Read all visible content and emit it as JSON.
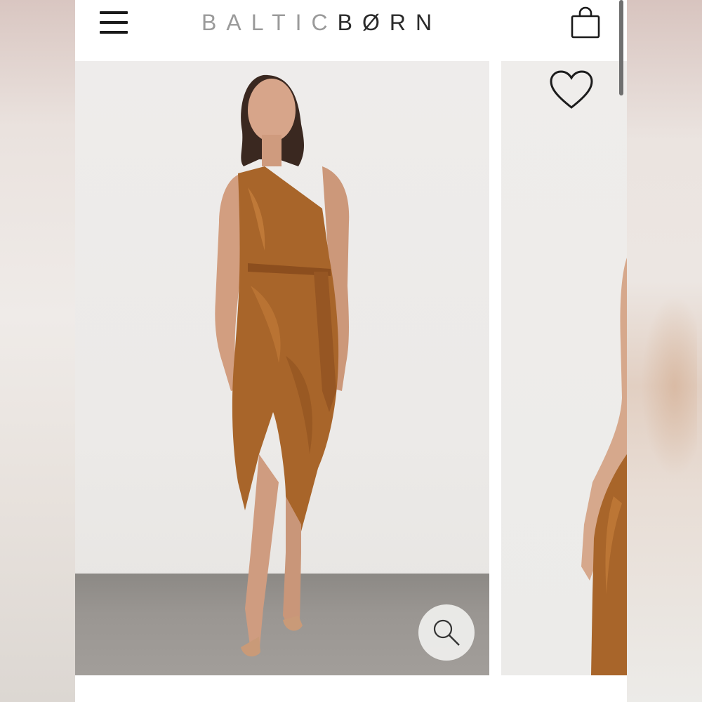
{
  "header": {
    "brand_left": "BALTIC",
    "brand_right": "BØRN"
  },
  "icons": {
    "menu": "hamburger-menu-icon",
    "bag": "shopping-bag-icon",
    "wishlist": "heart-icon",
    "zoom": "magnifier-icon"
  },
  "colors": {
    "dress": "#a8652a",
    "logo_light": "#9a9a9a",
    "logo_dark": "#2a2a2a"
  }
}
